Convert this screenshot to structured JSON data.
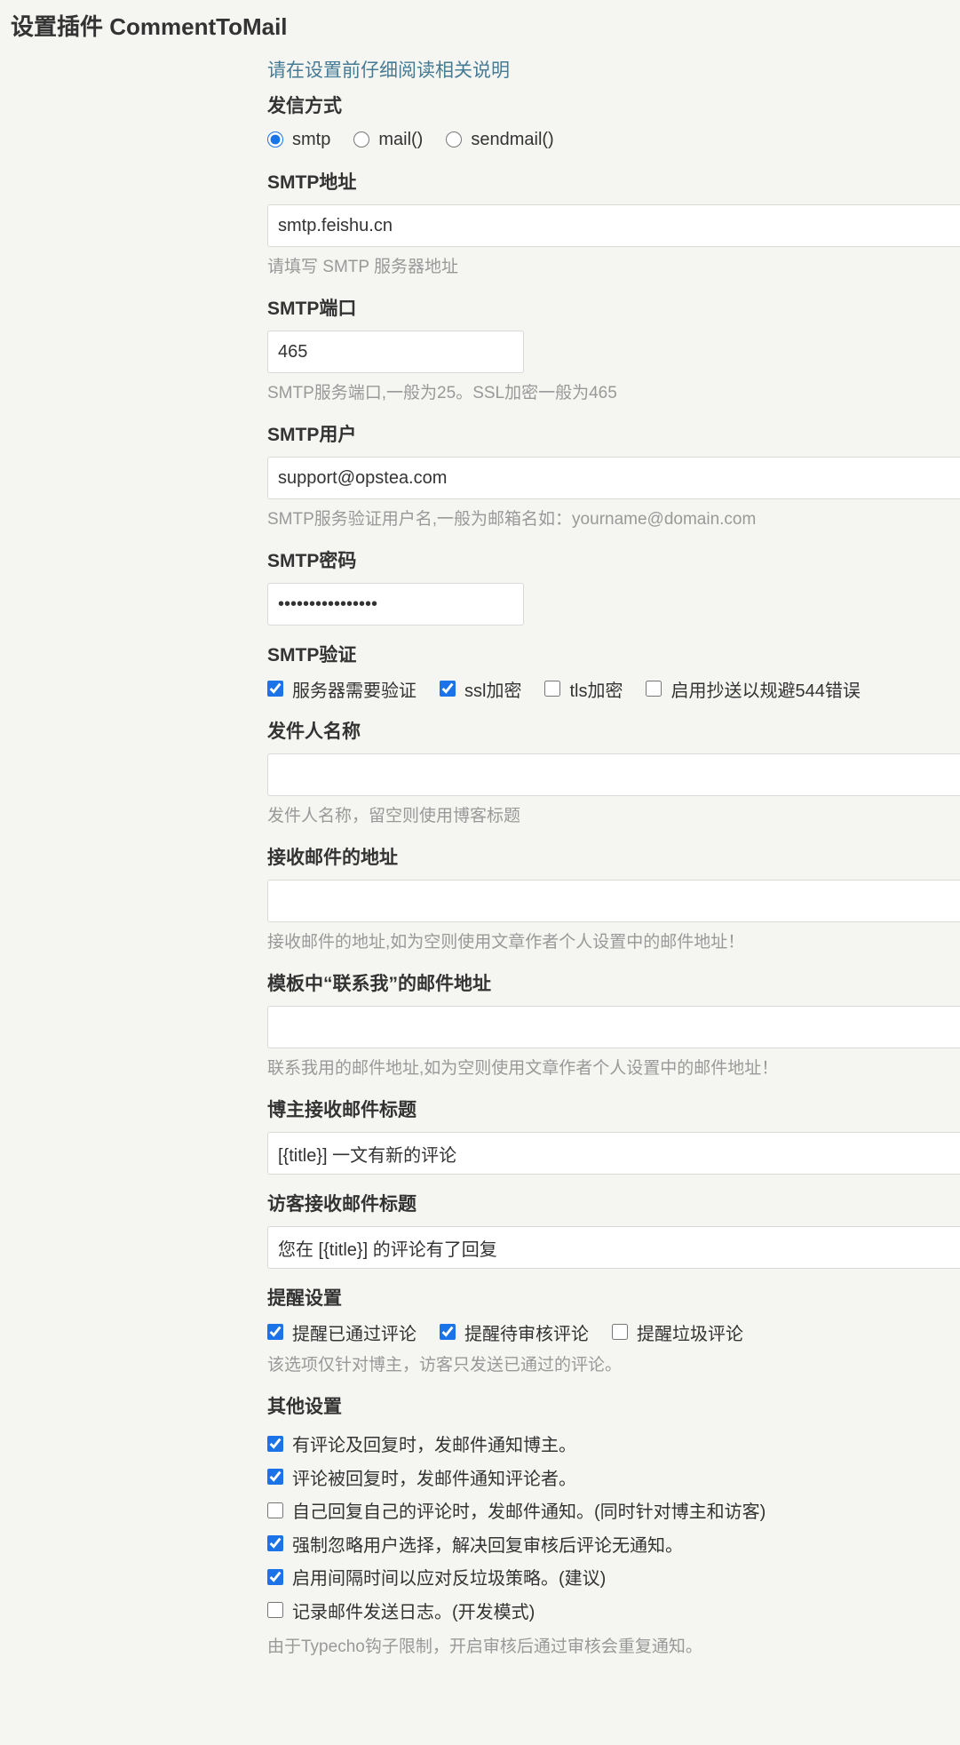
{
  "page_title": "设置插件 CommentToMail",
  "guide_link": "请在设置前仔细阅读相关说明",
  "send_method": {
    "label": "发信方式",
    "options": [
      {
        "label": "smtp",
        "checked": true
      },
      {
        "label": "mail()",
        "checked": false
      },
      {
        "label": "sendmail()",
        "checked": false
      }
    ]
  },
  "smtp_host": {
    "label": "SMTP地址",
    "value": "smtp.feishu.cn",
    "desc": "请填写 SMTP 服务器地址"
  },
  "smtp_port": {
    "label": "SMTP端口",
    "value": "465",
    "desc": "SMTP服务端口,一般为25。SSL加密一般为465"
  },
  "smtp_user": {
    "label": "SMTP用户",
    "value": "support@opstea.com",
    "desc": "SMTP服务验证用户名,一般为邮箱名如：yourname@domain.com"
  },
  "smtp_pass": {
    "label": "SMTP密码",
    "value": "****************"
  },
  "smtp_verify": {
    "label": "SMTP验证",
    "options": [
      {
        "label": "服务器需要验证",
        "checked": true
      },
      {
        "label": "ssl加密",
        "checked": true
      },
      {
        "label": "tls加密",
        "checked": false
      },
      {
        "label": "启用抄送以规避544错误",
        "checked": false
      }
    ]
  },
  "from_name": {
    "label": "发件人名称",
    "value": "",
    "desc": "发件人名称，留空则使用博客标题"
  },
  "recv_mail": {
    "label": "接收邮件的地址",
    "value": "",
    "desc": "接收邮件的地址,如为空则使用文章作者个人设置中的邮件地址！"
  },
  "contact_mail": {
    "label": "模板中“联系我”的邮件地址",
    "value": "",
    "desc": "联系我用的邮件地址,如为空则使用文章作者个人设置中的邮件地址！"
  },
  "owner_subject": {
    "label": "博主接收邮件标题",
    "value": "[{title}] 一文有新的评论"
  },
  "guest_subject": {
    "label": "访客接收邮件标题",
    "value": "您在 [{title}] 的评论有了回复"
  },
  "notify": {
    "label": "提醒设置",
    "options": [
      {
        "label": "提醒已通过评论",
        "checked": true
      },
      {
        "label": "提醒待审核评论",
        "checked": true
      },
      {
        "label": "提醒垃圾评论",
        "checked": false
      }
    ],
    "desc": "该选项仅针对博主，访客只发送已通过的评论。"
  },
  "other": {
    "label": "其他设置",
    "options": [
      {
        "label": "有评论及回复时，发邮件通知博主。",
        "checked": true
      },
      {
        "label": "评论被回复时，发邮件通知评论者。",
        "checked": true
      },
      {
        "label": "自己回复自己的评论时，发邮件通知。(同时针对博主和访客)",
        "checked": false
      },
      {
        "label": "强制忽略用户选择，解决回复审核后评论无通知。",
        "checked": true
      },
      {
        "label": "启用间隔时间以应对反垃圾策略。(建议)",
        "checked": true
      },
      {
        "label": "记录邮件发送日志。(开发模式)",
        "checked": false
      }
    ],
    "desc": "由于Typecho钩子限制，开启审核后通过审核会重复通知。"
  }
}
